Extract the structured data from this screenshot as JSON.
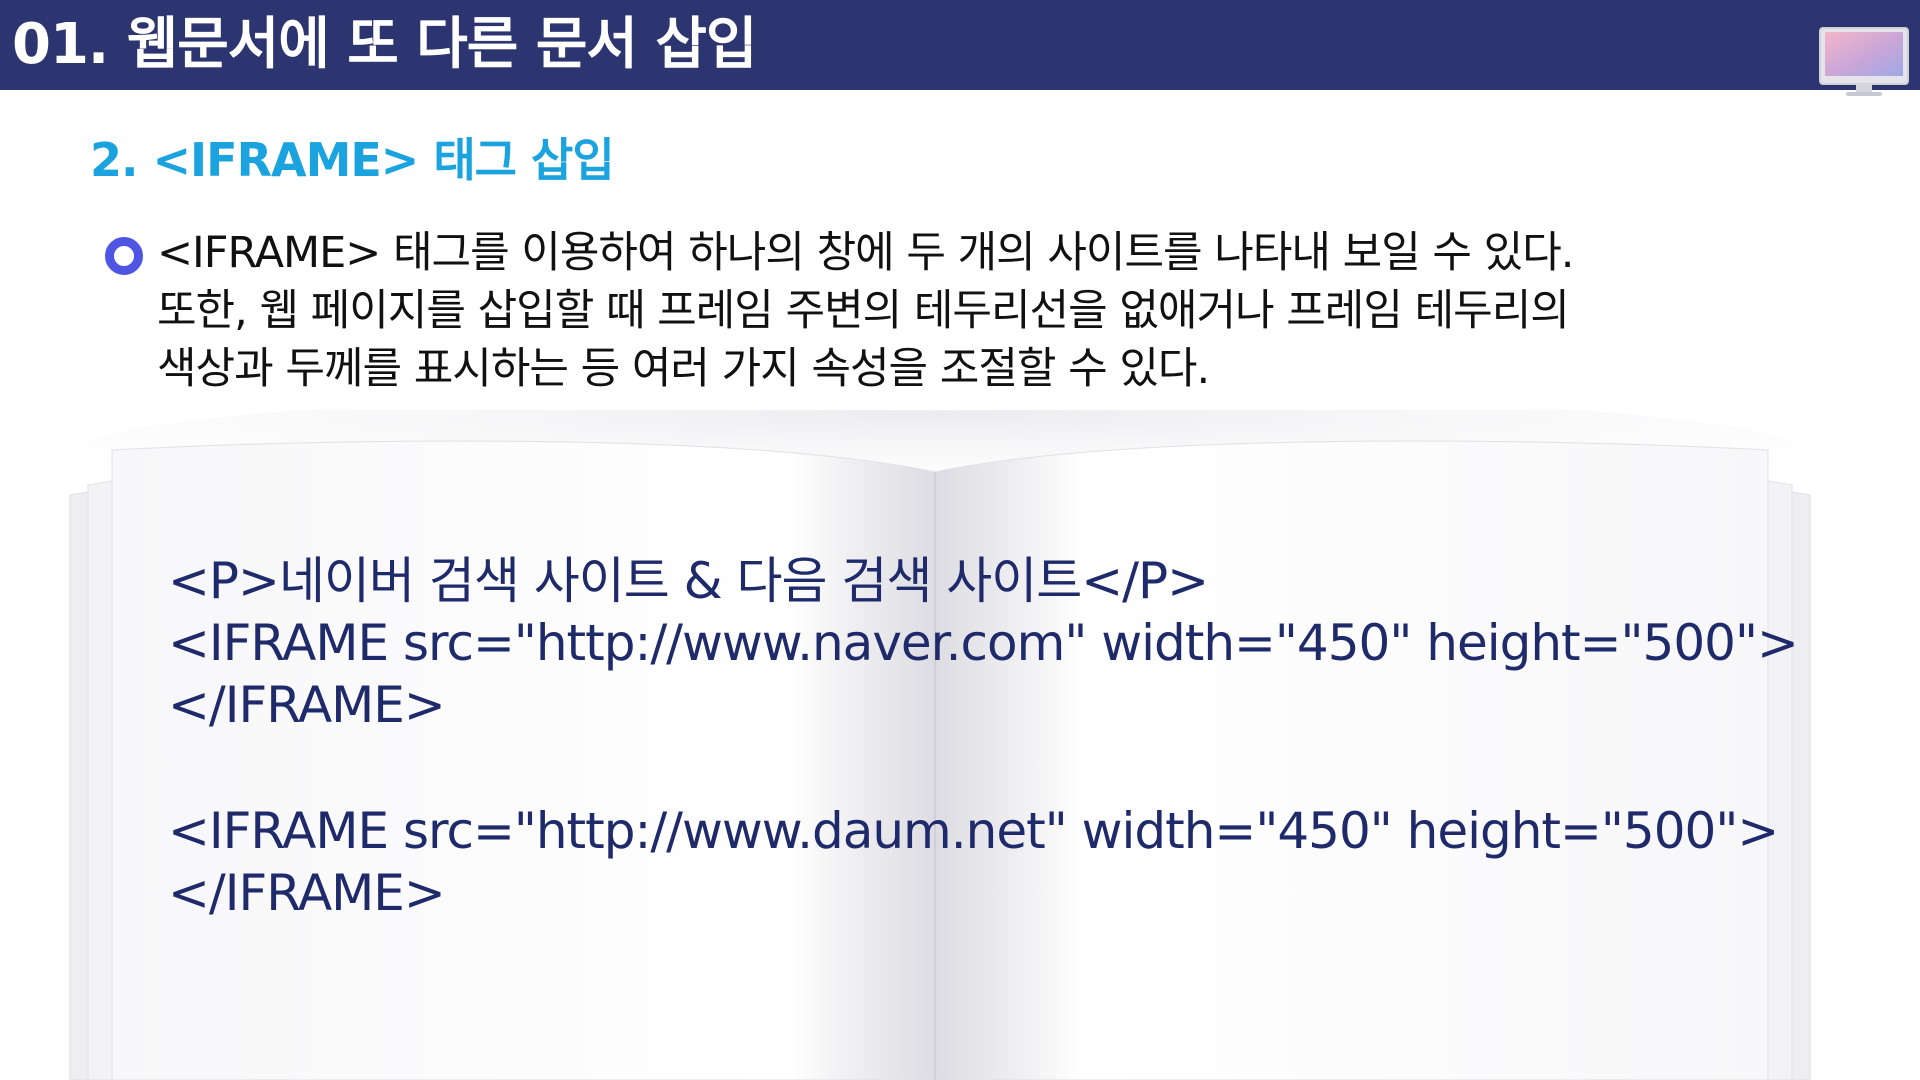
{
  "header": {
    "title": "01. 웹문서에 또 다른 문서 삽입",
    "icon": "monitor-icon",
    "background_color": "#2d3571"
  },
  "section": {
    "heading": "2. <IFRAME> 태그 삽입",
    "heading_color": "#1aa3de"
  },
  "description": {
    "bullet_icon": "circle-bullet-icon",
    "bullet_color": "#4f55e3",
    "lines": [
      "<IFRAME> 태그를 이용하여 하나의 창에 두 개의 사이트를 나타내 보일 수 있다.",
      "또한, 웹 페이지를 삽입할 때 프레임 주변의 테두리선을 없애거나 프레임 테두리의",
      "색상과 두께를 표시하는 등 여러 가지 속성을 조절할 수 있다."
    ]
  },
  "code_example": {
    "text_color": "#1f2a6b",
    "lines": [
      "<P>네이버 검색 사이트 & 다음 검색 사이트</P>",
      "<IFRAME src=\"http://www.naver.com\" width=\"450\" height=\"500\">",
      "</IFRAME>",
      "",
      "<IFRAME src=\"http://www.daum.net\" width=\"450\" height=\"500\">",
      "</IFRAME>"
    ]
  }
}
